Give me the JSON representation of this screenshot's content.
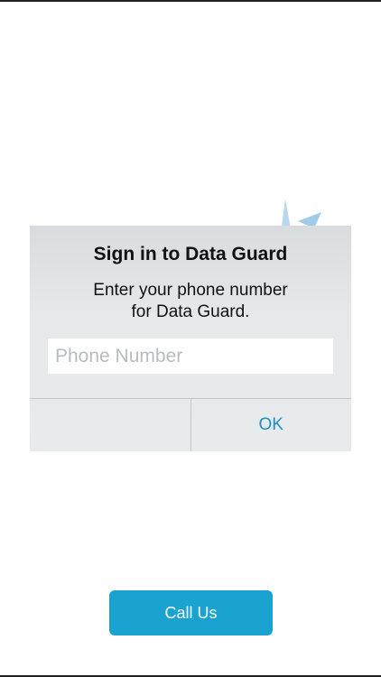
{
  "dialog": {
    "title": "Sign in to Data Guard",
    "message_line1": "Enter your phone number",
    "message_line2": "for Data Guard.",
    "input": {
      "placeholder": "Phone Number",
      "value": ""
    },
    "buttons": {
      "cancel_label": "",
      "ok_label": "OK"
    }
  },
  "call_button": {
    "label": "Call Us"
  },
  "colors": {
    "accent": "#1aa3d0",
    "link": "#1e8fc4",
    "logo": "#b8d8f0"
  },
  "icons": {
    "background_logo": "data-guard-logo-icon"
  }
}
